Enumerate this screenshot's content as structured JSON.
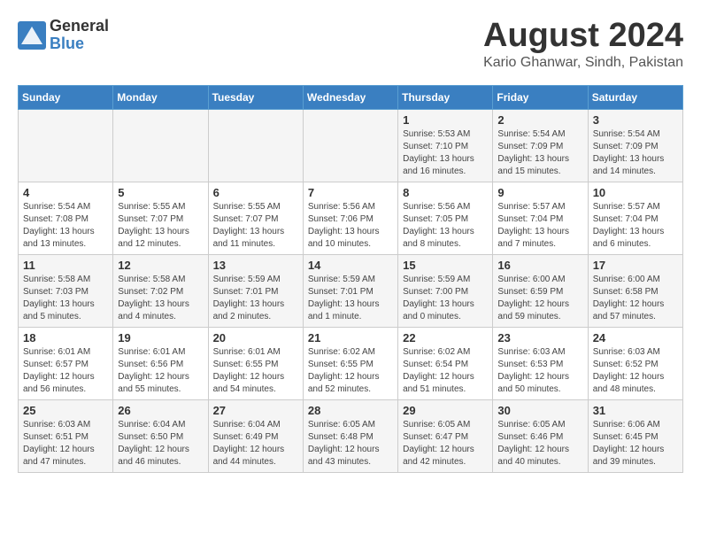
{
  "header": {
    "logo_general": "General",
    "logo_blue": "Blue",
    "month_title": "August 2024",
    "location": "Kario Ghanwar, Sindh, Pakistan"
  },
  "days_of_week": [
    "Sunday",
    "Monday",
    "Tuesday",
    "Wednesday",
    "Thursday",
    "Friday",
    "Saturday"
  ],
  "weeks": [
    [
      {
        "day": "",
        "info": ""
      },
      {
        "day": "",
        "info": ""
      },
      {
        "day": "",
        "info": ""
      },
      {
        "day": "",
        "info": ""
      },
      {
        "day": "1",
        "info": "Sunrise: 5:53 AM\nSunset: 7:10 PM\nDaylight: 13 hours\nand 16 minutes."
      },
      {
        "day": "2",
        "info": "Sunrise: 5:54 AM\nSunset: 7:09 PM\nDaylight: 13 hours\nand 15 minutes."
      },
      {
        "day": "3",
        "info": "Sunrise: 5:54 AM\nSunset: 7:09 PM\nDaylight: 13 hours\nand 14 minutes."
      }
    ],
    [
      {
        "day": "4",
        "info": "Sunrise: 5:54 AM\nSunset: 7:08 PM\nDaylight: 13 hours\nand 13 minutes."
      },
      {
        "day": "5",
        "info": "Sunrise: 5:55 AM\nSunset: 7:07 PM\nDaylight: 13 hours\nand 12 minutes."
      },
      {
        "day": "6",
        "info": "Sunrise: 5:55 AM\nSunset: 7:07 PM\nDaylight: 13 hours\nand 11 minutes."
      },
      {
        "day": "7",
        "info": "Sunrise: 5:56 AM\nSunset: 7:06 PM\nDaylight: 13 hours\nand 10 minutes."
      },
      {
        "day": "8",
        "info": "Sunrise: 5:56 AM\nSunset: 7:05 PM\nDaylight: 13 hours\nand 8 minutes."
      },
      {
        "day": "9",
        "info": "Sunrise: 5:57 AM\nSunset: 7:04 PM\nDaylight: 13 hours\nand 7 minutes."
      },
      {
        "day": "10",
        "info": "Sunrise: 5:57 AM\nSunset: 7:04 PM\nDaylight: 13 hours\nand 6 minutes."
      }
    ],
    [
      {
        "day": "11",
        "info": "Sunrise: 5:58 AM\nSunset: 7:03 PM\nDaylight: 13 hours\nand 5 minutes."
      },
      {
        "day": "12",
        "info": "Sunrise: 5:58 AM\nSunset: 7:02 PM\nDaylight: 13 hours\nand 4 minutes."
      },
      {
        "day": "13",
        "info": "Sunrise: 5:59 AM\nSunset: 7:01 PM\nDaylight: 13 hours\nand 2 minutes."
      },
      {
        "day": "14",
        "info": "Sunrise: 5:59 AM\nSunset: 7:01 PM\nDaylight: 13 hours\nand 1 minute."
      },
      {
        "day": "15",
        "info": "Sunrise: 5:59 AM\nSunset: 7:00 PM\nDaylight: 13 hours\nand 0 minutes."
      },
      {
        "day": "16",
        "info": "Sunrise: 6:00 AM\nSunset: 6:59 PM\nDaylight: 12 hours\nand 59 minutes."
      },
      {
        "day": "17",
        "info": "Sunrise: 6:00 AM\nSunset: 6:58 PM\nDaylight: 12 hours\nand 57 minutes."
      }
    ],
    [
      {
        "day": "18",
        "info": "Sunrise: 6:01 AM\nSunset: 6:57 PM\nDaylight: 12 hours\nand 56 minutes."
      },
      {
        "day": "19",
        "info": "Sunrise: 6:01 AM\nSunset: 6:56 PM\nDaylight: 12 hours\nand 55 minutes."
      },
      {
        "day": "20",
        "info": "Sunrise: 6:01 AM\nSunset: 6:55 PM\nDaylight: 12 hours\nand 54 minutes."
      },
      {
        "day": "21",
        "info": "Sunrise: 6:02 AM\nSunset: 6:55 PM\nDaylight: 12 hours\nand 52 minutes."
      },
      {
        "day": "22",
        "info": "Sunrise: 6:02 AM\nSunset: 6:54 PM\nDaylight: 12 hours\nand 51 minutes."
      },
      {
        "day": "23",
        "info": "Sunrise: 6:03 AM\nSunset: 6:53 PM\nDaylight: 12 hours\nand 50 minutes."
      },
      {
        "day": "24",
        "info": "Sunrise: 6:03 AM\nSunset: 6:52 PM\nDaylight: 12 hours\nand 48 minutes."
      }
    ],
    [
      {
        "day": "25",
        "info": "Sunrise: 6:03 AM\nSunset: 6:51 PM\nDaylight: 12 hours\nand 47 minutes."
      },
      {
        "day": "26",
        "info": "Sunrise: 6:04 AM\nSunset: 6:50 PM\nDaylight: 12 hours\nand 46 minutes."
      },
      {
        "day": "27",
        "info": "Sunrise: 6:04 AM\nSunset: 6:49 PM\nDaylight: 12 hours\nand 44 minutes."
      },
      {
        "day": "28",
        "info": "Sunrise: 6:05 AM\nSunset: 6:48 PM\nDaylight: 12 hours\nand 43 minutes."
      },
      {
        "day": "29",
        "info": "Sunrise: 6:05 AM\nSunset: 6:47 PM\nDaylight: 12 hours\nand 42 minutes."
      },
      {
        "day": "30",
        "info": "Sunrise: 6:05 AM\nSunset: 6:46 PM\nDaylight: 12 hours\nand 40 minutes."
      },
      {
        "day": "31",
        "info": "Sunrise: 6:06 AM\nSunset: 6:45 PM\nDaylight: 12 hours\nand 39 minutes."
      }
    ]
  ]
}
